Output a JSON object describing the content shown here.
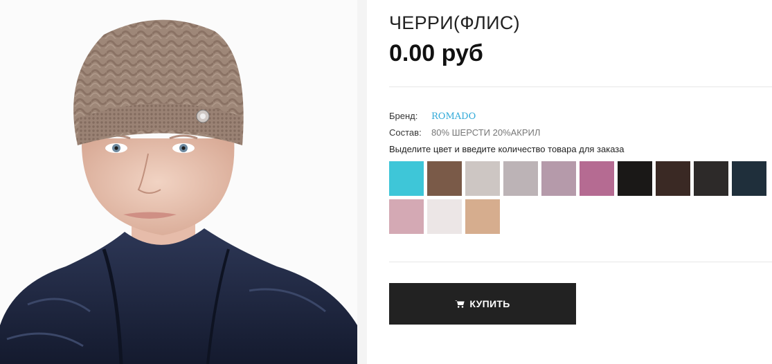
{
  "product": {
    "title": "ЧЕРРИ(ФЛИС)",
    "price": "0.00 руб"
  },
  "brand": {
    "label": "Бренд:",
    "value": "ROMADO"
  },
  "composition": {
    "label": "Состав:",
    "value": "80% ШЕРСТИ 20%АКРИЛ"
  },
  "instruction": "Выделите цвет и введите количество товара для заказа",
  "swatches": [
    {
      "color": "#3ec6d8"
    },
    {
      "color": "#7a5a48"
    },
    {
      "color": "#cdc6c3"
    },
    {
      "color": "#bcb3b6"
    },
    {
      "color": "#b59aaa"
    },
    {
      "color": "#b56b92"
    },
    {
      "color": "#1a1817"
    },
    {
      "color": "#3a2924"
    },
    {
      "color": "#2d2a29"
    },
    {
      "color": "#1f2f3b"
    },
    {
      "color": "#d4a9b4"
    },
    {
      "color": "#ece6e6"
    },
    {
      "color": "#d6ad8e"
    }
  ],
  "buy_button": {
    "label": "КУПИТЬ",
    "icon": "cart-icon"
  }
}
